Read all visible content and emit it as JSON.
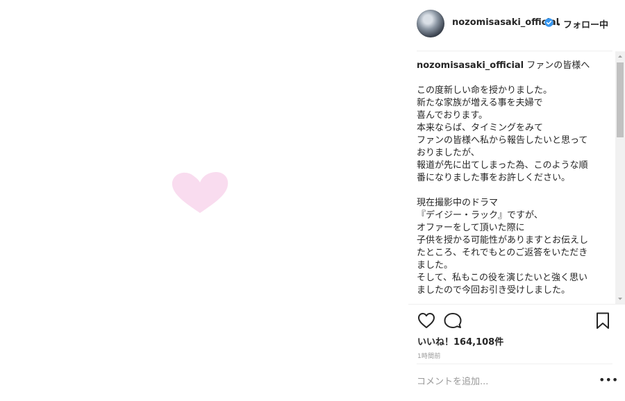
{
  "post": {
    "username": "nozomisasaki_official",
    "follow_status": "・フォロー中",
    "caption_first_line": "ファンの皆様へ",
    "caption_body": "\nこの度新しい命を授かりました。\n新たな家族が増える事を夫婦で\n喜んでおります。\n本来ならば、タイミングをみて\nファンの皆様へ私から報告したいと思って\nおりましたが、\n報道が先に出てしまった為、このような順\n番になりました事をお許しください。\n\n現在撮影中のドラマ\n『デイジー・ラック』ですが、\nオファーをして頂いた際に\n子供を授かる可能性がありますとお伝えし\nたところ、それでもとのご返答をいただき\nました。\nそして、私もこの役を演じたいと強く思い\nましたので今回お引き受けしました。\n\nドラマの撮影は、今までお仕事場での皆",
    "likes": "いいね！164,108件",
    "time": "1時間前"
  },
  "comment": {
    "placeholder": "コメントを追加..."
  },
  "icons": {
    "avatar": "profile-avatar",
    "verified": "verified-badge-icon",
    "like": "heart-outline-icon",
    "comment": "comment-bubble-icon",
    "save": "bookmark-icon",
    "more": "more-dots-icon"
  },
  "colors": {
    "verified": "#3897f0",
    "heart_image": "#f9dcef",
    "text": "#262626",
    "muted": "#999999"
  }
}
